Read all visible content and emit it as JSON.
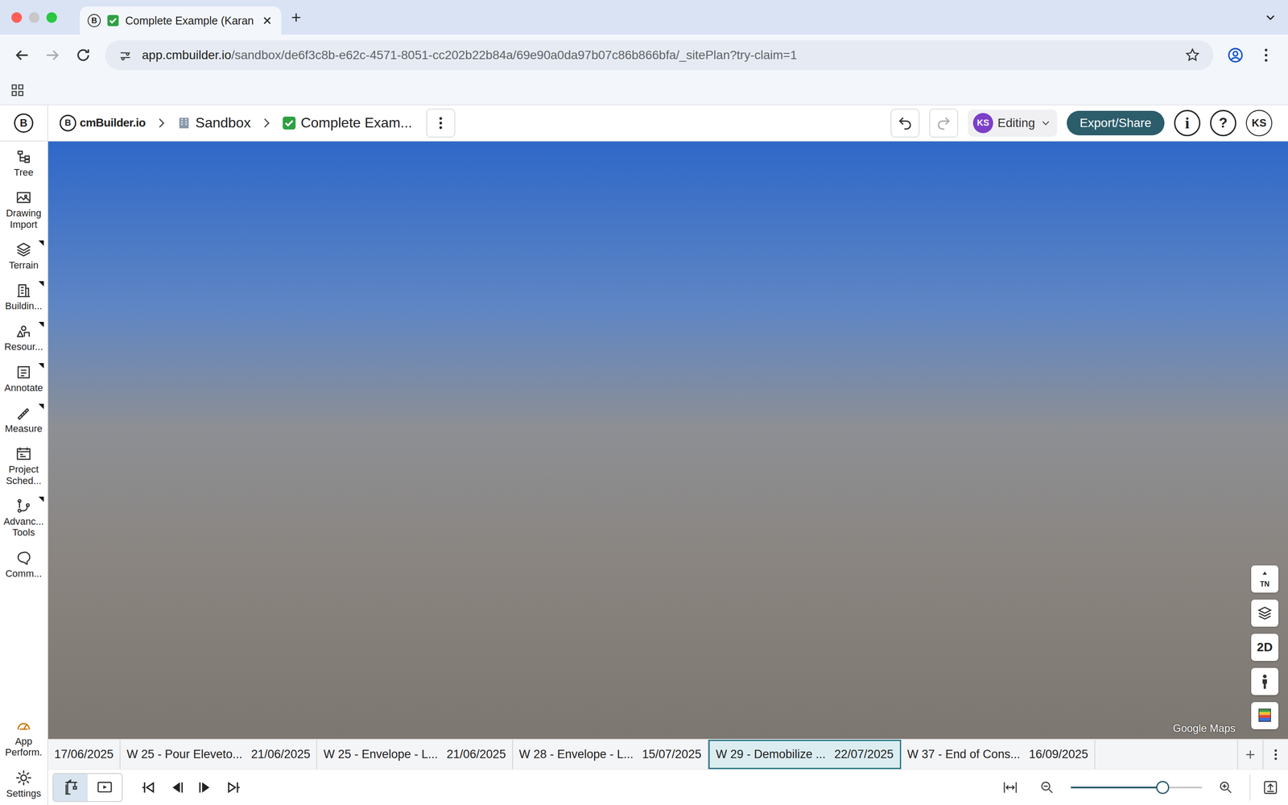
{
  "browser": {
    "tab_title": "Complete Example (Karan",
    "url_host": "app.cmbuilder.io",
    "url_path": "/sandbox/de6f3c8b-e62c-4571-8051-cc202b22b84a/69e90a0da97b07c86b866bfa/_sitePlan?try-claim=1"
  },
  "header": {
    "logo_mark": "B",
    "logo": "cmBuilder.io",
    "breadcrumbs": [
      "Sandbox",
      "Complete Exam..."
    ],
    "user_initials": "KS",
    "mode": "Editing",
    "export": "Export/Share",
    "info": "i",
    "help": "?",
    "avatar": "KS"
  },
  "sidebar": {
    "items": [
      {
        "label": "Tree",
        "has_menu": false
      },
      {
        "label": "Drawing Import",
        "has_menu": false
      },
      {
        "label": "Terrain",
        "has_menu": true
      },
      {
        "label": "Buildin...",
        "has_menu": true
      },
      {
        "label": "Resour...",
        "has_menu": true
      },
      {
        "label": "Annotate",
        "has_menu": true
      },
      {
        "label": "Measure",
        "has_menu": true
      },
      {
        "label": "Project Sched...",
        "has_menu": false
      },
      {
        "label": "Advanc... Tools",
        "has_menu": true
      },
      {
        "label": "Comm...",
        "has_menu": false
      }
    ],
    "bottom_items": [
      "App Perform.",
      "Settings"
    ]
  },
  "map": {
    "compass": "TN",
    "view_2d": "2D",
    "attribution": "Google Maps"
  },
  "timeline": [
    {
      "date": "17/06/2025",
      "selected": false
    },
    {
      "label": "W 25 - Pour Eleveto...",
      "date": "21/06/2025",
      "selected": false
    },
    {
      "label": "W 25 - Envelope - L...",
      "date": "21/06/2025",
      "selected": false
    },
    {
      "label": "W 28 - Envelope - L...",
      "date": "15/07/2025",
      "selected": false
    },
    {
      "label": "W 29 - Demobilize ...",
      "date": "22/07/2025",
      "selected": true
    },
    {
      "label": "W 37 - End of Cons...",
      "date": "16/09/2025",
      "selected": false
    }
  ],
  "controls": {
    "modes": [
      {
        "name": "site",
        "selected": true
      },
      {
        "name": "presentation",
        "selected": false
      }
    ],
    "zoom_level": 0.7
  }
}
